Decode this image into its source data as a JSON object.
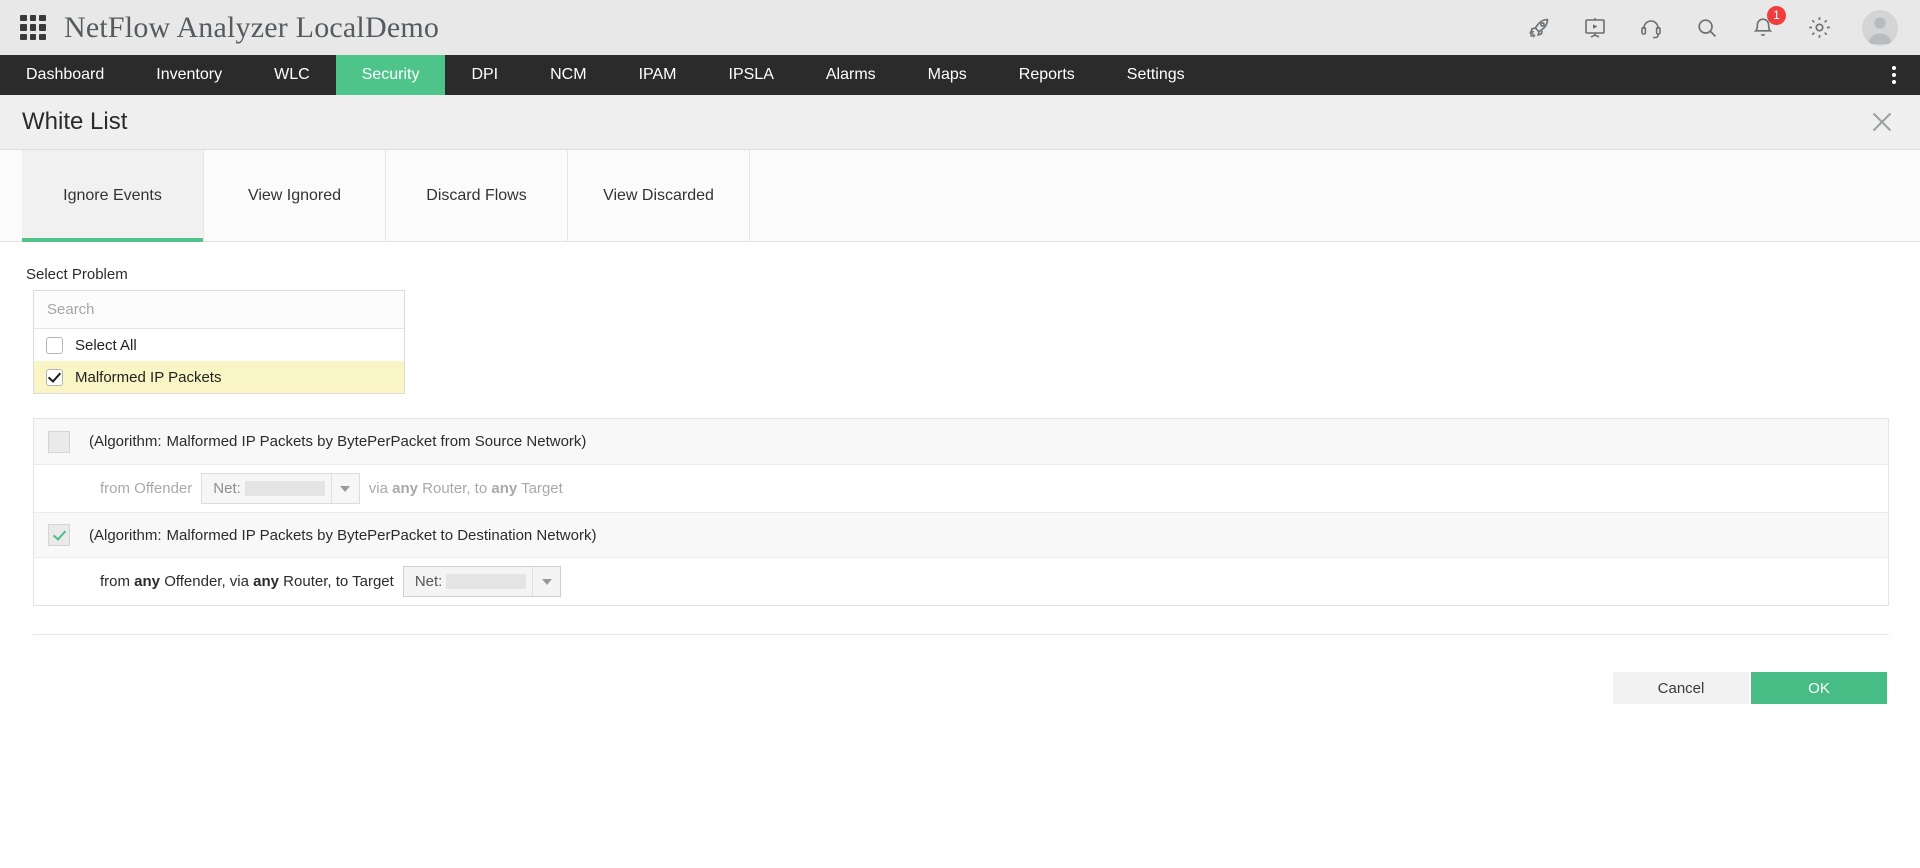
{
  "titlebar": {
    "app_title": "NetFlow Analyzer LocalDemo",
    "menu_icon": "apps-grid-icon",
    "icons": [
      {
        "name": "rocket-icon",
        "label": "Rocket"
      },
      {
        "name": "presentation-icon",
        "label": "Presentation"
      },
      {
        "name": "headset-icon",
        "label": "Support Headset"
      },
      {
        "name": "search-icon",
        "label": "Search"
      },
      {
        "name": "bell-icon",
        "label": "Notifications"
      },
      {
        "name": "gear-icon",
        "label": "Settings"
      },
      {
        "name": "avatar-icon",
        "label": "User Profile"
      }
    ],
    "notification_count": "1"
  },
  "nav": {
    "items": [
      {
        "label": "Dashboard",
        "active": false
      },
      {
        "label": "Inventory",
        "active": false
      },
      {
        "label": "WLC",
        "active": false
      },
      {
        "label": "Security",
        "active": true
      },
      {
        "label": "DPI",
        "active": false
      },
      {
        "label": "NCM",
        "active": false
      },
      {
        "label": "IPAM",
        "active": false
      },
      {
        "label": "IPSLA",
        "active": false
      },
      {
        "label": "Alarms",
        "active": false
      },
      {
        "label": "Maps",
        "active": false
      },
      {
        "label": "Reports",
        "active": false
      },
      {
        "label": "Settings",
        "active": false
      }
    ],
    "overflow_icon": "kebab-menu-icon"
  },
  "page": {
    "title": "White List",
    "close_icon": "close-icon"
  },
  "tabs": [
    {
      "label": "Ignore Events",
      "active": true
    },
    {
      "label": "View Ignored",
      "active": false
    },
    {
      "label": "Discard Flows",
      "active": false
    },
    {
      "label": "View Discarded",
      "active": false
    }
  ],
  "select_problem": {
    "label": "Select Problem",
    "search_placeholder": "Search",
    "search_value": "",
    "options": [
      {
        "label": "Select All",
        "checked": false,
        "highlighted": false
      },
      {
        "label": "Malformed IP Packets",
        "checked": true,
        "highlighted": true
      }
    ]
  },
  "algorithms": [
    {
      "checked": false,
      "enabled": false,
      "title_lead": "(Algorithm:",
      "title_text": "Malformed IP Packets by BytePerPacket from Source Network)",
      "condition": {
        "pre_text": "from Offender",
        "dropdown_label": "Net:",
        "dropdown_value": "",
        "post_plain_1": "via ",
        "post_bold_1": "any",
        "post_plain_2": " Router, to ",
        "post_bold_2": "any",
        "post_plain_3": " Target",
        "dropdown_position": "middle"
      }
    },
    {
      "checked": true,
      "enabled": true,
      "title_lead": "(Algorithm:",
      "title_text": "Malformed IP Packets by BytePerPacket to Destination Network)",
      "condition": {
        "pre_plain_1": "from ",
        "pre_bold_1": "any",
        "pre_plain_2": " Offender, via ",
        "pre_bold_2": "any",
        "pre_plain_3": " Router, to Target",
        "dropdown_label": "Net:",
        "dropdown_value": "",
        "dropdown_position": "end"
      }
    }
  ],
  "footer": {
    "cancel_label": "Cancel",
    "ok_label": "OK"
  },
  "colors": {
    "accent_green": "#4ec38a",
    "ok_green": "#47bc85",
    "nav_dark": "#2b2b2b",
    "highlight_yellow": "#faf5c4",
    "badge_red": "#ef3d3d"
  }
}
